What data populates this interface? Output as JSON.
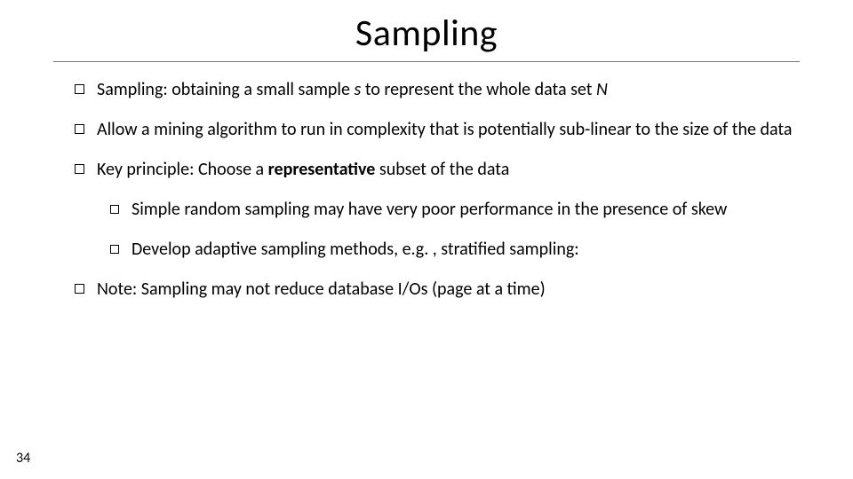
{
  "title": "Sampling",
  "bullets": {
    "b1_pre": "Sampling: obtaining a small sample ",
    "b1_s": "s",
    "b1_mid": " to represent the whole data set ",
    "b1_N": "N",
    "b2": "Allow a mining algorithm to run in complexity that is potentially sub-linear to the size of the data",
    "b3_pre": "Key principle: Choose a ",
    "b3_bold": "representative",
    "b3_post": " subset of the data",
    "b3a": "Simple random sampling may have very poor performance in the presence of skew",
    "b3b": "Develop adaptive sampling methods, e.g. , stratified sampling:",
    "b4": "Note: Sampling may not reduce database I/Os (page at a time)"
  },
  "page": "34"
}
